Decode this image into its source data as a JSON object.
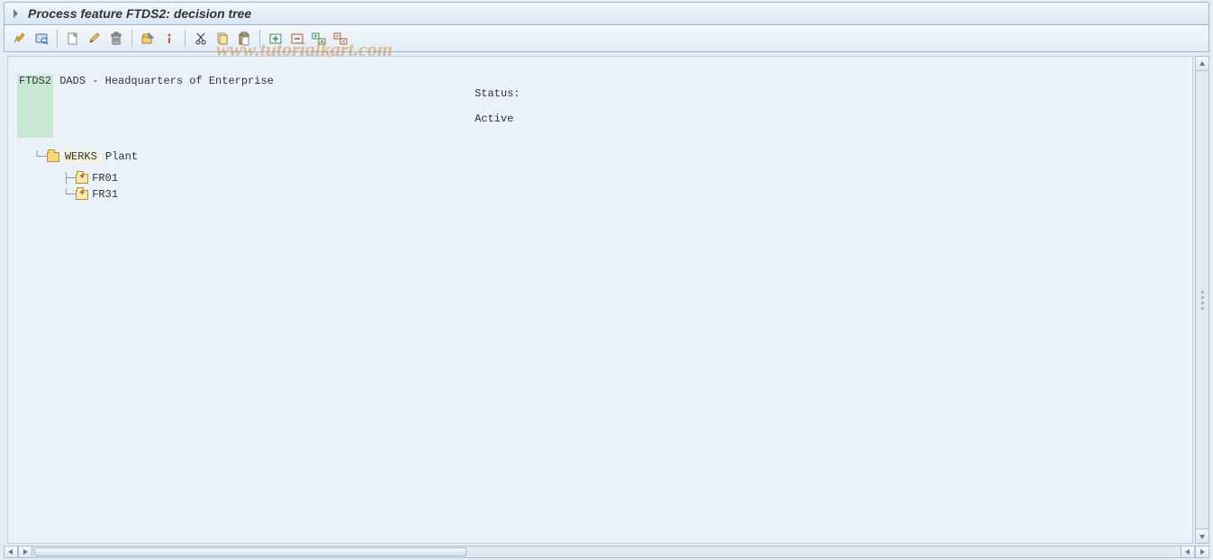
{
  "header": {
    "title": "Process feature FTDS2: decision tree"
  },
  "toolbar": {
    "icons": [
      "check-icon",
      "display-icon",
      "sep",
      "create-icon",
      "change-icon",
      "delete-icon",
      "sep",
      "other-icon",
      "info-icon",
      "sep",
      "cut-icon",
      "copy-icon",
      "paste-icon",
      "sep",
      "expand-icon",
      "collapse-icon",
      "expand-all-icon",
      "collapse-all-icon"
    ]
  },
  "tree": {
    "root_code": "FTDS2",
    "root_desc": "DADS - Headquarters of Enterprise",
    "status_label": "Status:",
    "status_value": "Active",
    "node1_code": "WERKS",
    "node1_desc": "Plant",
    "leaf1": "FR01",
    "leaf2": "FR31"
  },
  "watermark": "www.tutorialkart.com"
}
